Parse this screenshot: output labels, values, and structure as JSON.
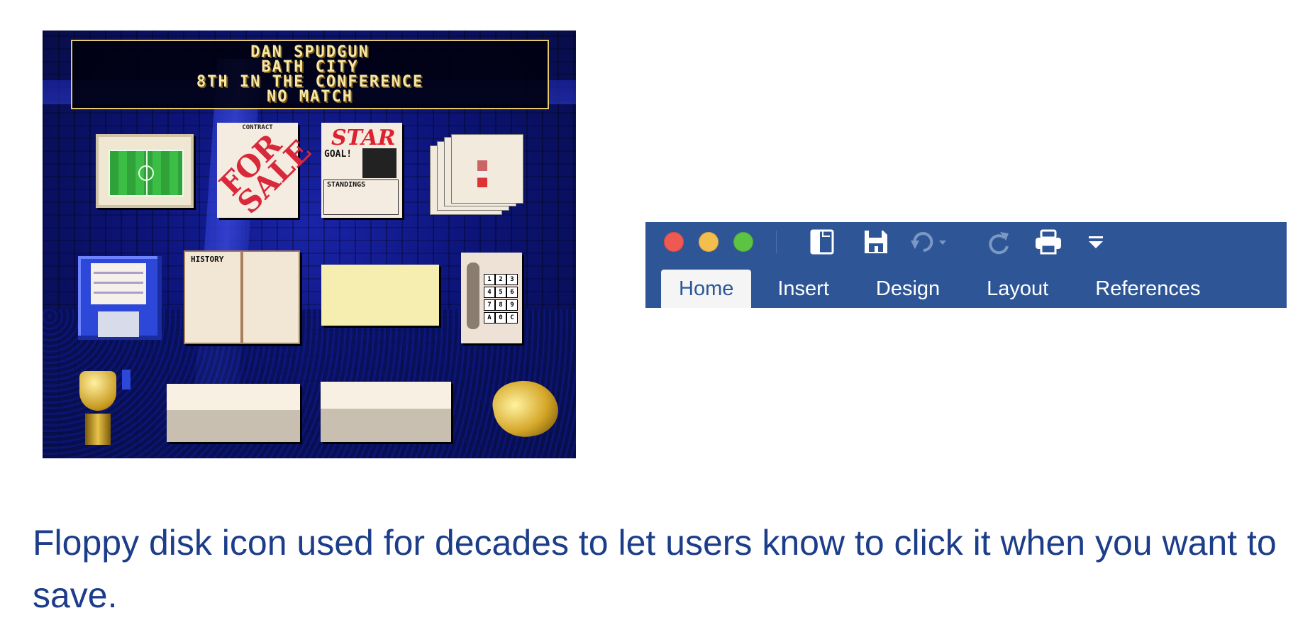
{
  "game_screen": {
    "scorebox": {
      "manager": "DAN SPUDGUN",
      "club": "BATH CITY",
      "league_position": "8TH IN THE CONFERENCE",
      "match_status": "NO MATCH"
    },
    "icons": {
      "contract_header": "CONTRACT",
      "contract_stamp": "FOR SALE",
      "newspaper_masthead": "STAR",
      "newspaper_headline": "GOAL!",
      "standings_label": "STANDINGS",
      "history_label": "HISTORY",
      "phone_keys": [
        "1",
        "2",
        "3",
        "4",
        "5",
        "6",
        "7",
        "8",
        "9",
        "A",
        "0",
        "C"
      ]
    }
  },
  "word_toolbar": {
    "window_controls": [
      "close",
      "minimize",
      "zoom"
    ],
    "quick_access_icons": [
      "sidebar-icon",
      "save-icon",
      "undo-icon",
      "redo-icon",
      "print-icon",
      "customize-icon"
    ],
    "tabs": [
      {
        "label": "Home",
        "active": true
      },
      {
        "label": "Insert",
        "active": false
      },
      {
        "label": "Design",
        "active": false
      },
      {
        "label": "Layout",
        "active": false
      },
      {
        "label": "References",
        "active": false
      }
    ],
    "colors": {
      "toolbar_bg": "#2e5697",
      "active_tab_bg": "#f5f5f5",
      "active_tab_text": "#2b5797"
    }
  },
  "caption": "Floppy disk icon used for decades to let users know to click it when you want to save.",
  "colors": {
    "caption": "#1c3d8a"
  }
}
